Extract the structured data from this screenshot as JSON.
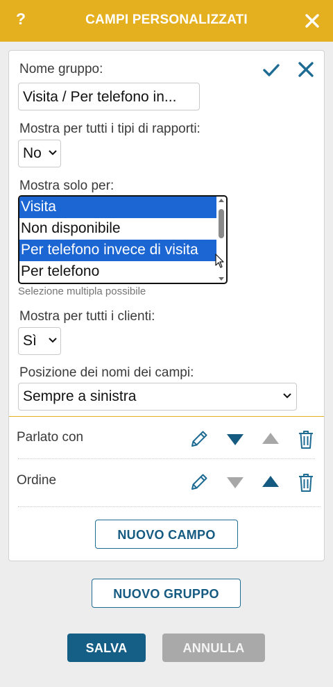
{
  "header": {
    "help_label": "?",
    "title": "CAMPI PERSONALIZZATI"
  },
  "group": {
    "name_label": "Nome gruppo:",
    "name_value": "Visita / Per telefono in...",
    "show_all_report_types_label": "Mostra per tutti i tipi di rapporti:",
    "show_all_report_types_value": "No",
    "show_only_for_label": "Mostra solo per:",
    "show_only_for_options": [
      {
        "label": "Visita",
        "selected": true
      },
      {
        "label": "Non disponibile",
        "selected": false
      },
      {
        "label": "Per telefono invece di visita",
        "selected": true
      },
      {
        "label": "Per telefono",
        "selected": false
      }
    ],
    "multi_select_hint": "Selezione multipla possibile",
    "show_all_clients_label": "Mostra per tutti i clienti:",
    "show_all_clients_value": "Sì",
    "field_name_position_label": "Posizione dei nomi dei campi:",
    "field_name_position_value": "Sempre a sinistra"
  },
  "fields": [
    {
      "name": "Parlato con",
      "move_down_enabled": true,
      "move_up_enabled": false
    },
    {
      "name": "Ordine",
      "move_down_enabled": false,
      "move_up_enabled": true
    }
  ],
  "buttons": {
    "new_field": "NUOVO CAMPO",
    "new_group": "NUOVO GRUPPO",
    "save": "SALVA",
    "cancel": "ANNULLA"
  },
  "colors": {
    "header_bg": "#e5b020",
    "primary": "#1e6b93",
    "selection": "#1c66d4",
    "disabled": "#a7a7a7"
  }
}
